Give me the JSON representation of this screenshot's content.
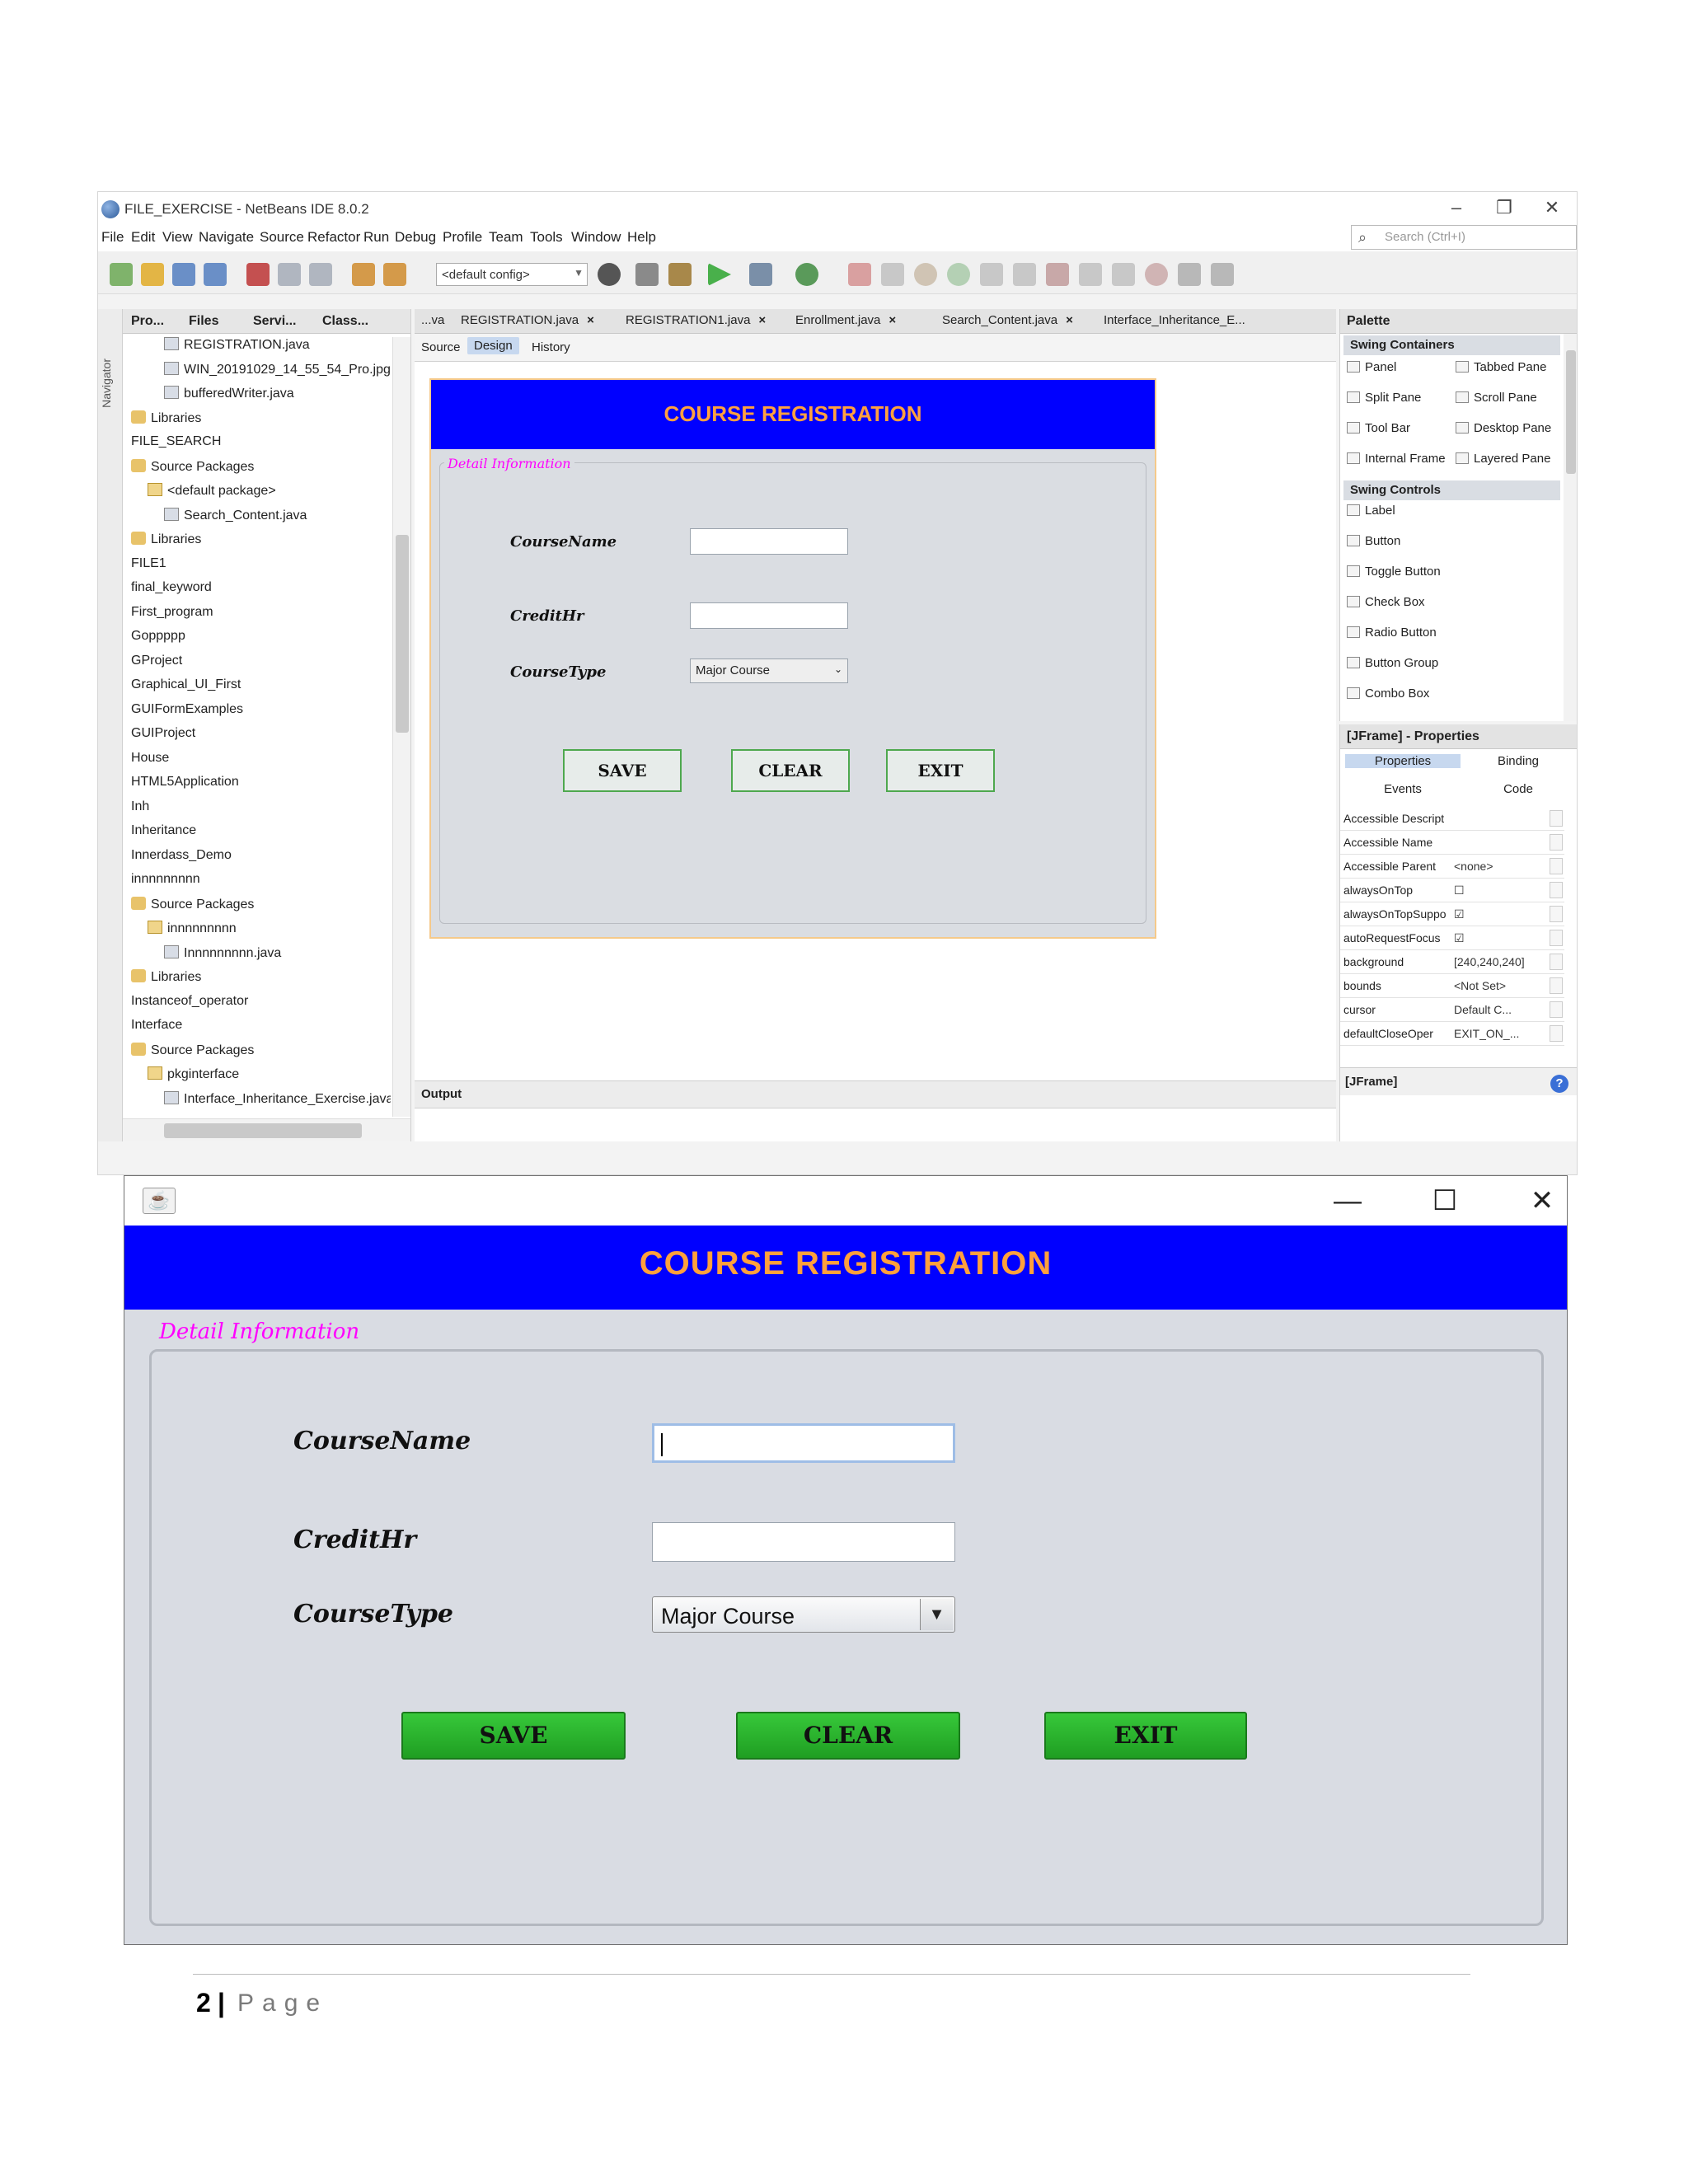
{
  "ide": {
    "title": "FILE_EXERCISE - NetBeans IDE 8.0.2",
    "window_controls": {
      "minimize": "–",
      "restore": "❐",
      "close": "✕"
    },
    "menu": [
      "File",
      "Edit",
      "View",
      "Navigate",
      "Source",
      "Refactor",
      "Run",
      "Debug",
      "Profile",
      "Team",
      "Tools",
      "Window",
      "Help"
    ],
    "search_placeholder": "Search (Ctrl+I)",
    "config_select": "<default config>",
    "project_tabs": [
      "Pro...",
      "Files",
      "Servi...",
      "Class..."
    ],
    "navigator_label": "Navigator",
    "tree": [
      {
        "label": "REGISTRATION.java",
        "icon": "java"
      },
      {
        "label": "WIN_20191029_14_55_54_Pro.jpg",
        "icon": "java"
      },
      {
        "label": "bufferedWriter.java",
        "icon": "java"
      },
      {
        "label": "Libraries",
        "icon": "lib"
      },
      {
        "label": "FILE_SEARCH",
        "icon": "none"
      },
      {
        "label": "Source Packages",
        "icon": "lib"
      },
      {
        "label": "<default package>",
        "icon": "pkg"
      },
      {
        "label": "Search_Content.java",
        "icon": "java"
      },
      {
        "label": "Libraries",
        "icon": "lib"
      },
      {
        "label": "FILE1",
        "icon": "none"
      },
      {
        "label": "final_keyword",
        "icon": "none"
      },
      {
        "label": "First_program",
        "icon": "none"
      },
      {
        "label": "Goppppp",
        "icon": "none"
      },
      {
        "label": "GProject",
        "icon": "none"
      },
      {
        "label": "Graphical_UI_First",
        "icon": "none"
      },
      {
        "label": "GUIFormExamples",
        "icon": "none"
      },
      {
        "label": "GUIProject",
        "icon": "none"
      },
      {
        "label": "House",
        "icon": "none"
      },
      {
        "label": "HTML5Application",
        "icon": "none"
      },
      {
        "label": "Inh",
        "icon": "none"
      },
      {
        "label": "Inheritance",
        "icon": "none"
      },
      {
        "label": "Innerdass_Demo",
        "icon": "none"
      },
      {
        "label": "innnnnnnnn",
        "icon": "none"
      },
      {
        "label": "Source Packages",
        "icon": "lib"
      },
      {
        "label": "innnnnnnnn",
        "icon": "pkg"
      },
      {
        "label": "Innnnnnnnn.java",
        "icon": "java"
      },
      {
        "label": "Libraries",
        "icon": "lib"
      },
      {
        "label": "Instanceof_operator",
        "icon": "none"
      },
      {
        "label": "Interface",
        "icon": "none"
      },
      {
        "label": "Source Packages",
        "icon": "lib"
      },
      {
        "label": "pkginterface",
        "icon": "pkg"
      },
      {
        "label": "Interface_Inheritance_Exercise.java",
        "icon": "java"
      }
    ],
    "file_tabs": [
      "...va",
      "REGISTRATION.java",
      "REGISTRATION1.java",
      "Enrollment.java",
      "Search_Content.java",
      "Interface_Inheritance_E..."
    ],
    "view_tabs": [
      "Source",
      "Design",
      "History"
    ],
    "preview": {
      "title": "COURSE REGISTRATION",
      "group_title": "Detail Information",
      "labels": [
        "CourseName",
        "CreditHr",
        "CourseType"
      ],
      "select_value": "Major Course",
      "buttons": [
        "SAVE",
        "CLEAR",
        "EXIT"
      ]
    },
    "output_label": "Output",
    "palette": {
      "title": "Palette",
      "sections": [
        "Swing Containers",
        "Swing Controls"
      ],
      "containers": [
        "Panel",
        "Tabbed Pane",
        "Split Pane",
        "Scroll Pane",
        "Tool Bar",
        "Desktop Pane",
        "Internal Frame",
        "Layered Pane"
      ],
      "controls": [
        "Label",
        "Button",
        "Toggle Button",
        "Check Box",
        "Radio Button",
        "Button Group",
        "Combo Box"
      ]
    },
    "properties": {
      "title": "[JFrame] - Properties",
      "tabs": [
        "Properties",
        "Binding",
        "Events",
        "Code"
      ],
      "rows": [
        {
          "k": "Accessible Descript",
          "v": ""
        },
        {
          "k": "Accessible Name",
          "v": ""
        },
        {
          "k": "Accessible Parent",
          "v": "<none>"
        },
        {
          "k": "alwaysOnTop",
          "v": "☐"
        },
        {
          "k": "alwaysOnTopSuppo",
          "v": "☑"
        },
        {
          "k": "autoRequestFocus",
          "v": "☑"
        },
        {
          "k": "background",
          "v": "[240,240,240]"
        },
        {
          "k": "bounds",
          "v": "<Not Set>"
        },
        {
          "k": "cursor",
          "v": "Default C..."
        },
        {
          "k": "defaultCloseOper",
          "v": "EXIT_ON_..."
        }
      ],
      "footer": "[JFrame]"
    }
  },
  "app": {
    "window_controls": {
      "minimize": "—",
      "maximize": "☐",
      "close": "✕"
    },
    "title": "COURSE REGISTRATION",
    "group_title": "Detail Information",
    "course_name_label": "CourseName",
    "credit_hr_label": "CreditHr",
    "course_type_label": "CourseType",
    "course_name_value": "",
    "credit_hr_value": "",
    "course_type_value": "Major Course",
    "save_label": "SAVE",
    "clear_label": "CLEAR",
    "exit_label": "EXIT"
  },
  "page_footer": {
    "number": "2",
    "separator": "|",
    "word": "Page"
  },
  "colors": {
    "banner": "#0000ff",
    "banner_text": "#ffa040",
    "group_title": "#ff00ff",
    "button_green": "#2db42f"
  }
}
